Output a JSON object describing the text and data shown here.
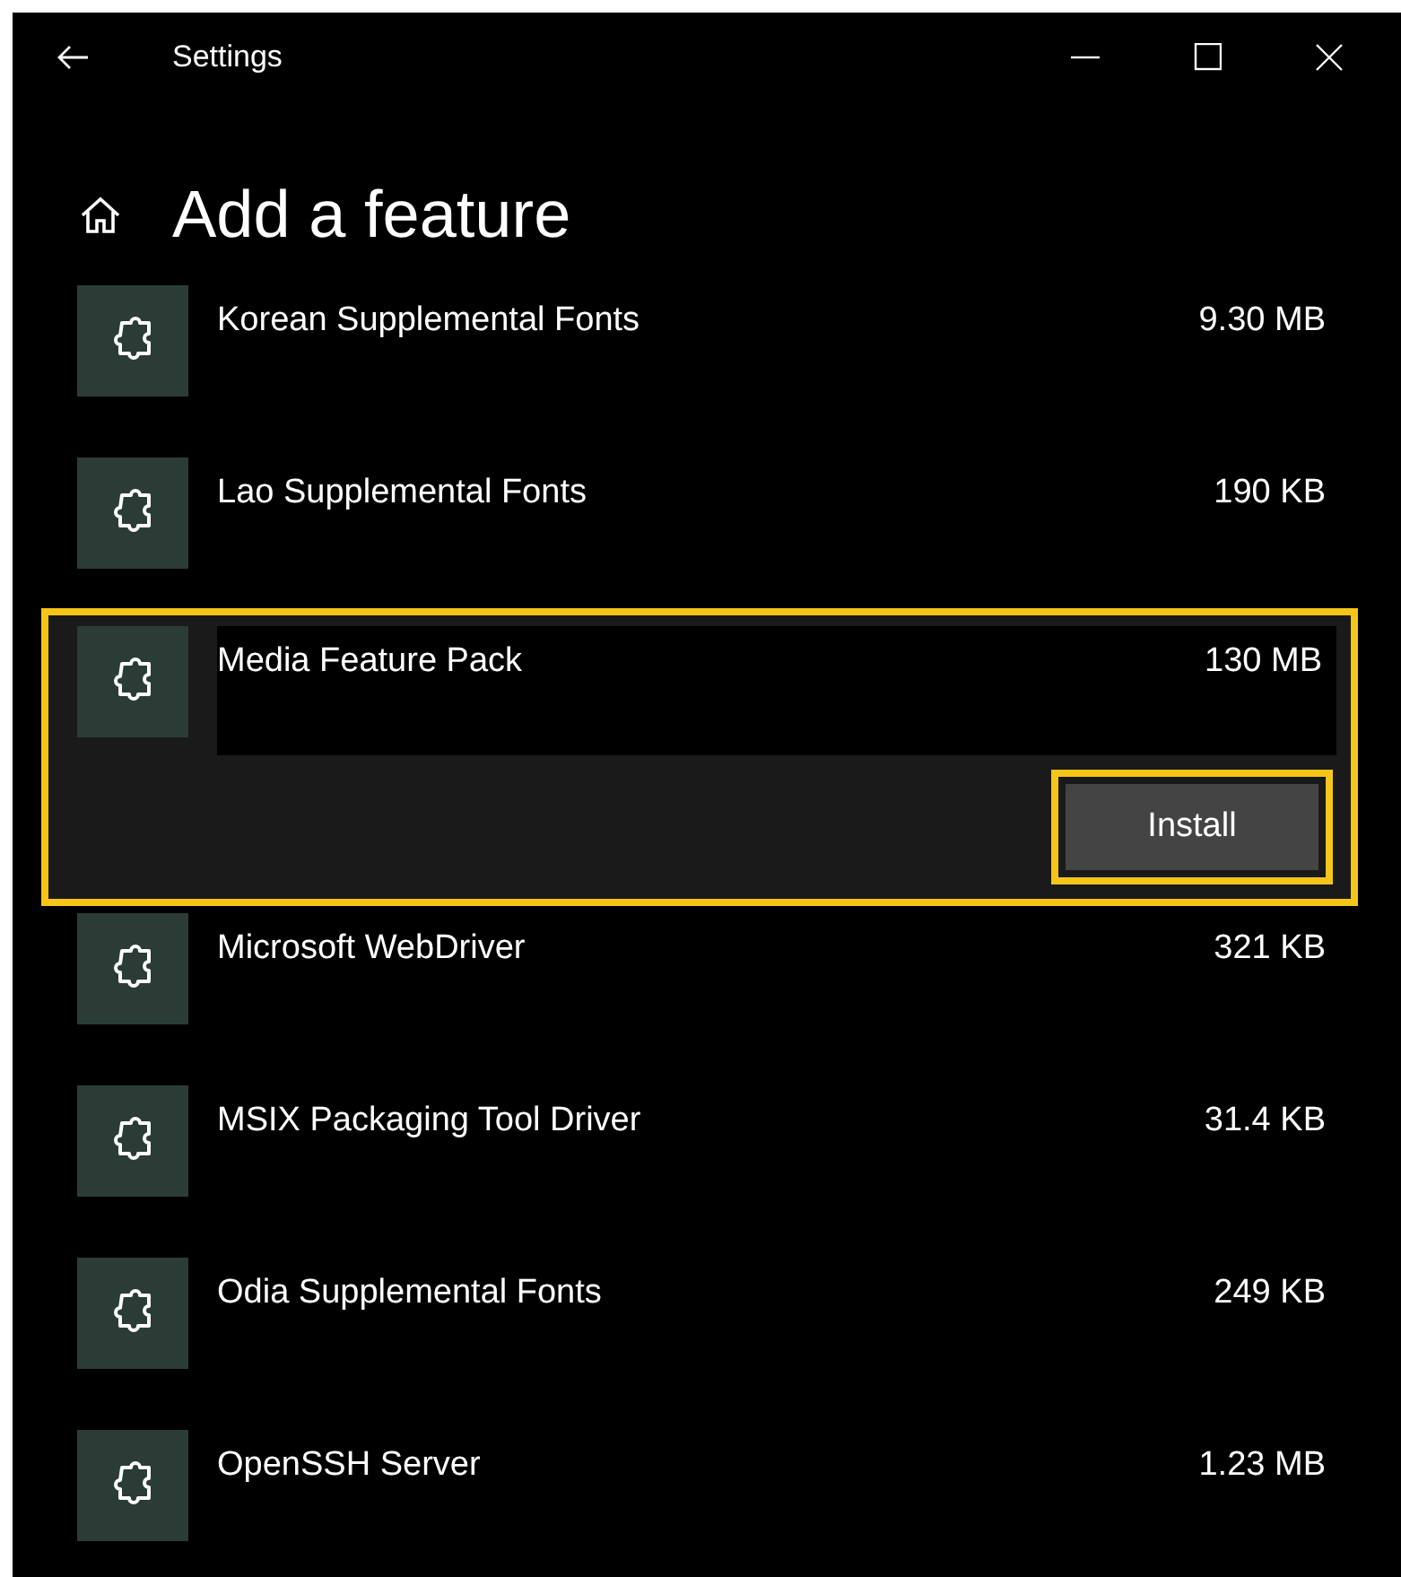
{
  "window": {
    "title": "Settings"
  },
  "page": {
    "title": "Add a feature"
  },
  "features": [
    {
      "name": "Korean Supplemental Fonts",
      "size": "9.30 MB",
      "expanded": false,
      "highlighted": false
    },
    {
      "name": "Lao Supplemental Fonts",
      "size": "190 KB",
      "expanded": false,
      "highlighted": false
    },
    {
      "name": "Media Feature Pack",
      "size": "130 MB",
      "expanded": true,
      "highlighted": true,
      "button": {
        "label": "Install",
        "highlighted": true
      }
    },
    {
      "name": "Microsoft WebDriver",
      "size": "321 KB",
      "expanded": false,
      "highlighted": false
    },
    {
      "name": "MSIX Packaging Tool Driver",
      "size": "31.4 KB",
      "expanded": false,
      "highlighted": false
    },
    {
      "name": "Odia Supplemental Fonts",
      "size": "249 KB",
      "expanded": false,
      "highlighted": false
    },
    {
      "name": "OpenSSH Server",
      "size": "1.23 MB",
      "expanded": false,
      "highlighted": false
    }
  ]
}
